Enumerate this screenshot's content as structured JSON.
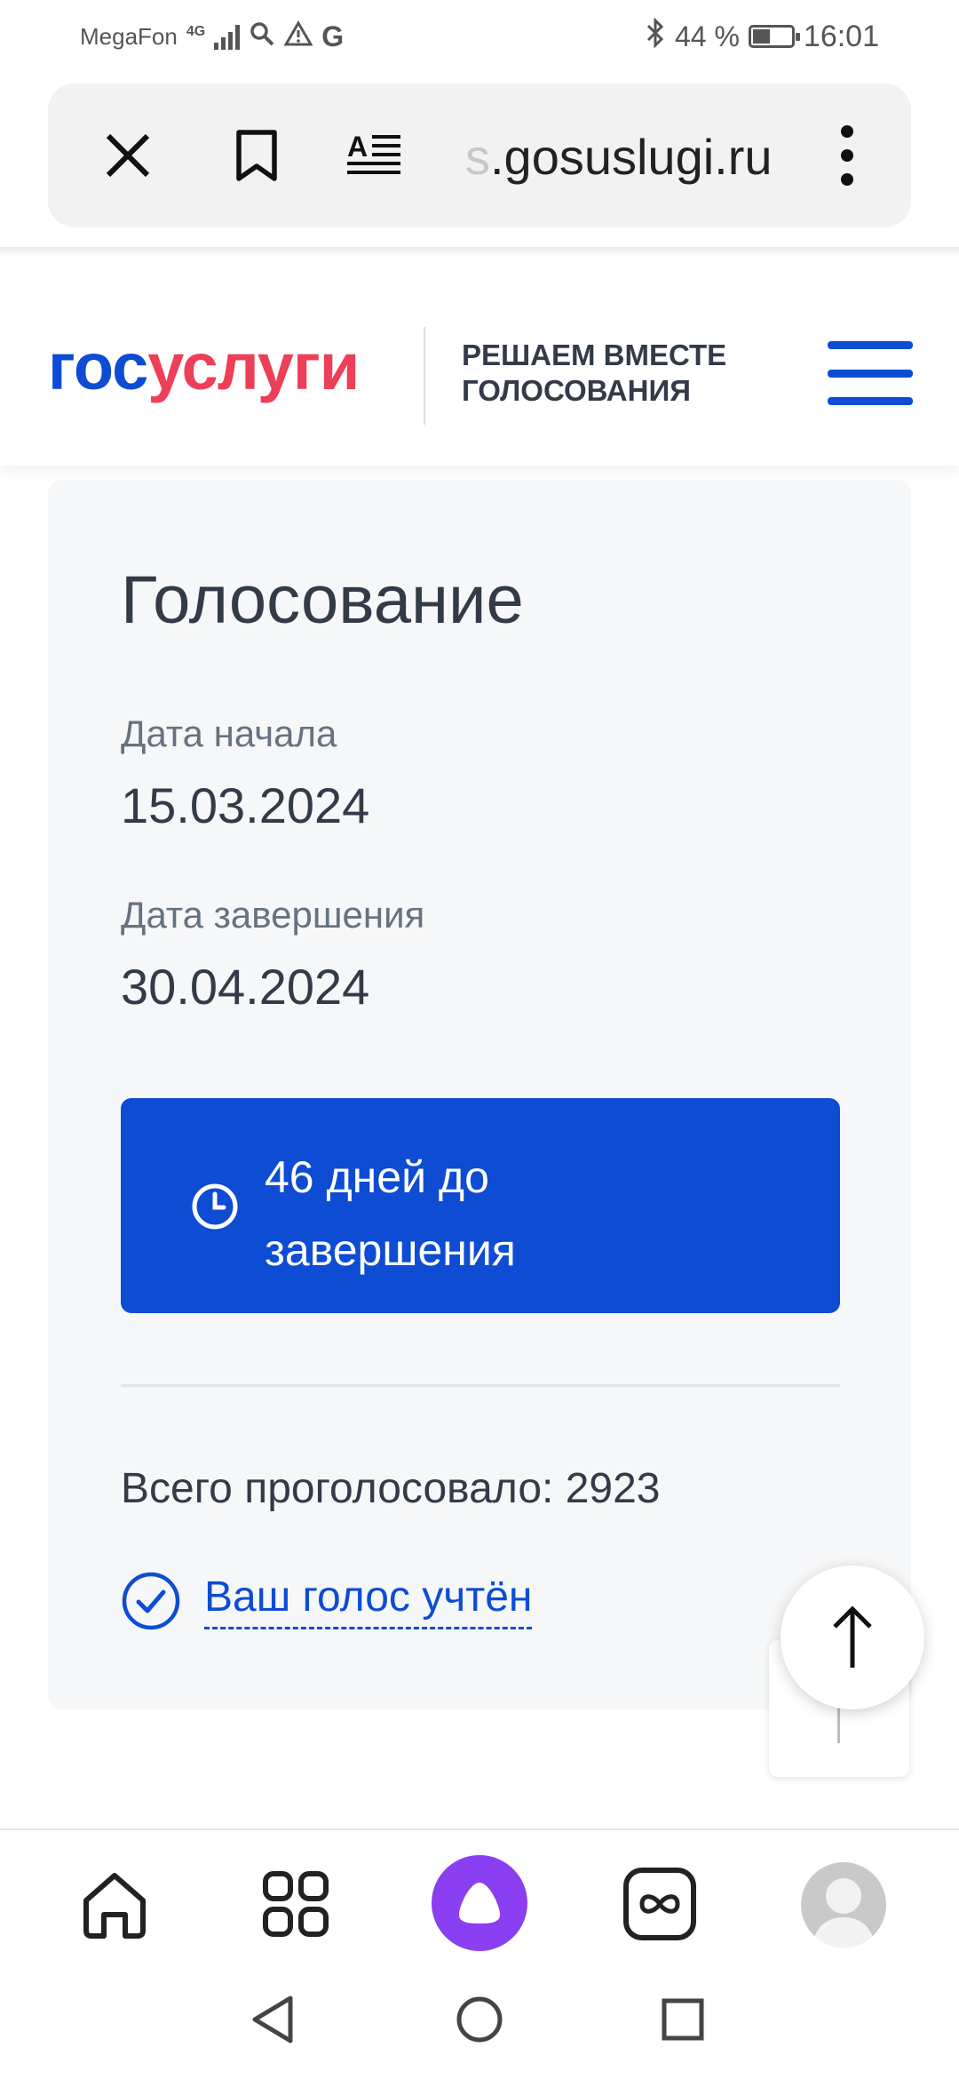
{
  "status_bar": {
    "carrier": "MegaFon",
    "network": "4G",
    "battery": "44 %",
    "battery_level": 0.44,
    "time": "16:01",
    "icons": [
      "signal-icon",
      "search-icon",
      "warning-icon",
      "google-icon",
      "bluetooth-icon",
      "battery-icon"
    ]
  },
  "browser": {
    "url_prefix": "s",
    "url": ".gosuslugi.ru",
    "icons": [
      "close-icon",
      "bookmark-icon",
      "reader-mode-icon",
      "more-vert-icon"
    ]
  },
  "header": {
    "logo_part1": "гос",
    "logo_part2": "услуги",
    "tagline": "РЕШАЕМ ВМЕСТЕ ГОЛОСОВАНИЯ",
    "menu_icon": "hamburger-menu-icon",
    "colors": {
      "brand_blue": "#0d4cd3",
      "brand_red": "#ee3f58"
    }
  },
  "voting": {
    "title": "Голосование",
    "start_label": "Дата начала",
    "start_date": "15.03.2024",
    "end_label": "Дата завершения",
    "end_date": "30.04.2024",
    "days_left": "46 дней до завершения",
    "total_votes": "Всего проголосовало: 2923",
    "vote_status": "Ваш голос учтён"
  },
  "bottom_nav": {
    "items": [
      "home-icon",
      "apps-grid-icon",
      "alice-assistant-icon",
      "infinity-icon",
      "profile-avatar"
    ]
  },
  "android_nav": {
    "items": [
      "back-icon",
      "home-circle-icon",
      "recents-icon"
    ]
  }
}
